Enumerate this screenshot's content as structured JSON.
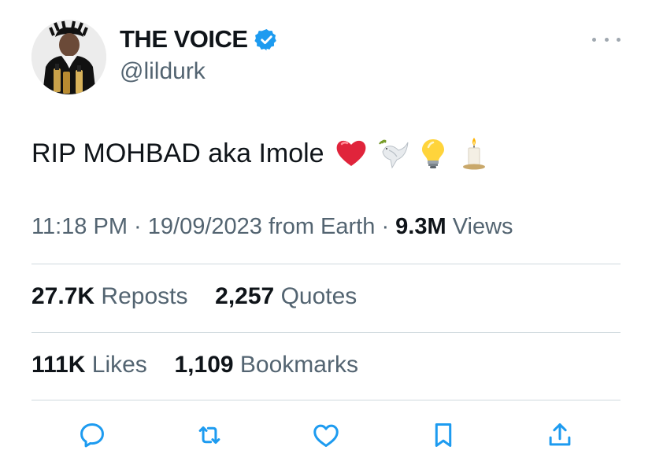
{
  "author": {
    "display_name": "THE VOICE",
    "handle": "@lildurk",
    "verified": true,
    "verified_color": "#1d9bf0"
  },
  "more_icon": "more-dots-icon",
  "tweet": {
    "text": "RIP MOHBAD aka Imole",
    "emojis": [
      "red-heart",
      "dove",
      "light-bulb",
      "candle"
    ]
  },
  "meta": {
    "time": "11:18 PM",
    "separator": "·",
    "date": "19/09/2023",
    "location": "from Earth",
    "views_count": "9.3M",
    "views_label": "Views"
  },
  "engagement": {
    "reposts_count": "27.7K",
    "reposts_label": "Reposts",
    "quotes_count": "2,257",
    "quotes_label": "Quotes",
    "likes_count": "111K",
    "likes_label": "Likes",
    "bookmarks_count": "1,109",
    "bookmarks_label": "Bookmarks"
  },
  "actions": [
    "reply-icon",
    "repost-icon",
    "like-icon",
    "bookmark-icon",
    "share-icon"
  ],
  "colors": {
    "text": "#0f1419",
    "secondary": "#536471",
    "icon": "#1d9bf0",
    "divider": "#cfd9de"
  }
}
